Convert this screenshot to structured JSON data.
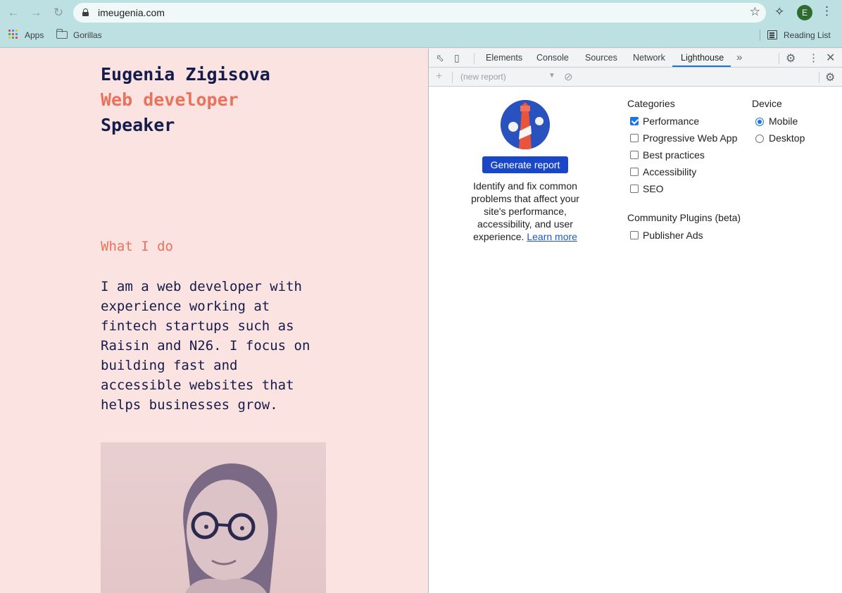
{
  "browser": {
    "url": "imeugenia.com",
    "profile_initial": "E",
    "bookmarks": [
      {
        "label": "Apps"
      },
      {
        "label": "Gorillas"
      }
    ],
    "reading_list": "Reading List"
  },
  "site": {
    "name": "Eugenia Zigisova",
    "role_primary": "Web developer",
    "role_secondary": "Speaker",
    "section_title": "What I do",
    "bio_lines": [
      "I am a web developer with",
      "experience working at",
      "fintech startups such as",
      "Raisin and N26. I focus on",
      "building fast and",
      "accessible websites that",
      "helps businesses grow."
    ],
    "colors": {
      "navy": "#141c4c",
      "coral": "#e8735c",
      "background": "#fbe3e1"
    }
  },
  "devtools": {
    "tabs": [
      {
        "label": "Elements"
      },
      {
        "label": "Console"
      },
      {
        "label": "Sources"
      },
      {
        "label": "Network"
      },
      {
        "label": "Lighthouse"
      }
    ],
    "active_tab": "Lighthouse",
    "report_select": "(new report)",
    "lighthouse": {
      "generate_button": "Generate report",
      "description_lines": [
        "Identify and fix common",
        "problems that affect your",
        "site's performance,",
        "accessibility, and user"
      ],
      "description_last": "experience.",
      "learn_more": "Learn more",
      "categories_title": "Categories",
      "categories": [
        {
          "label": "Performance",
          "checked": true
        },
        {
          "label": "Progressive Web App",
          "checked": false
        },
        {
          "label": "Best practices",
          "checked": false
        },
        {
          "label": "Accessibility",
          "checked": false
        },
        {
          "label": "SEO",
          "checked": false
        }
      ],
      "plugins_title": "Community Plugins (beta)",
      "plugins": [
        {
          "label": "Publisher Ads",
          "checked": false
        }
      ],
      "device_title": "Device",
      "devices": [
        {
          "label": "Mobile",
          "checked": true
        },
        {
          "label": "Desktop",
          "checked": false
        }
      ]
    }
  }
}
